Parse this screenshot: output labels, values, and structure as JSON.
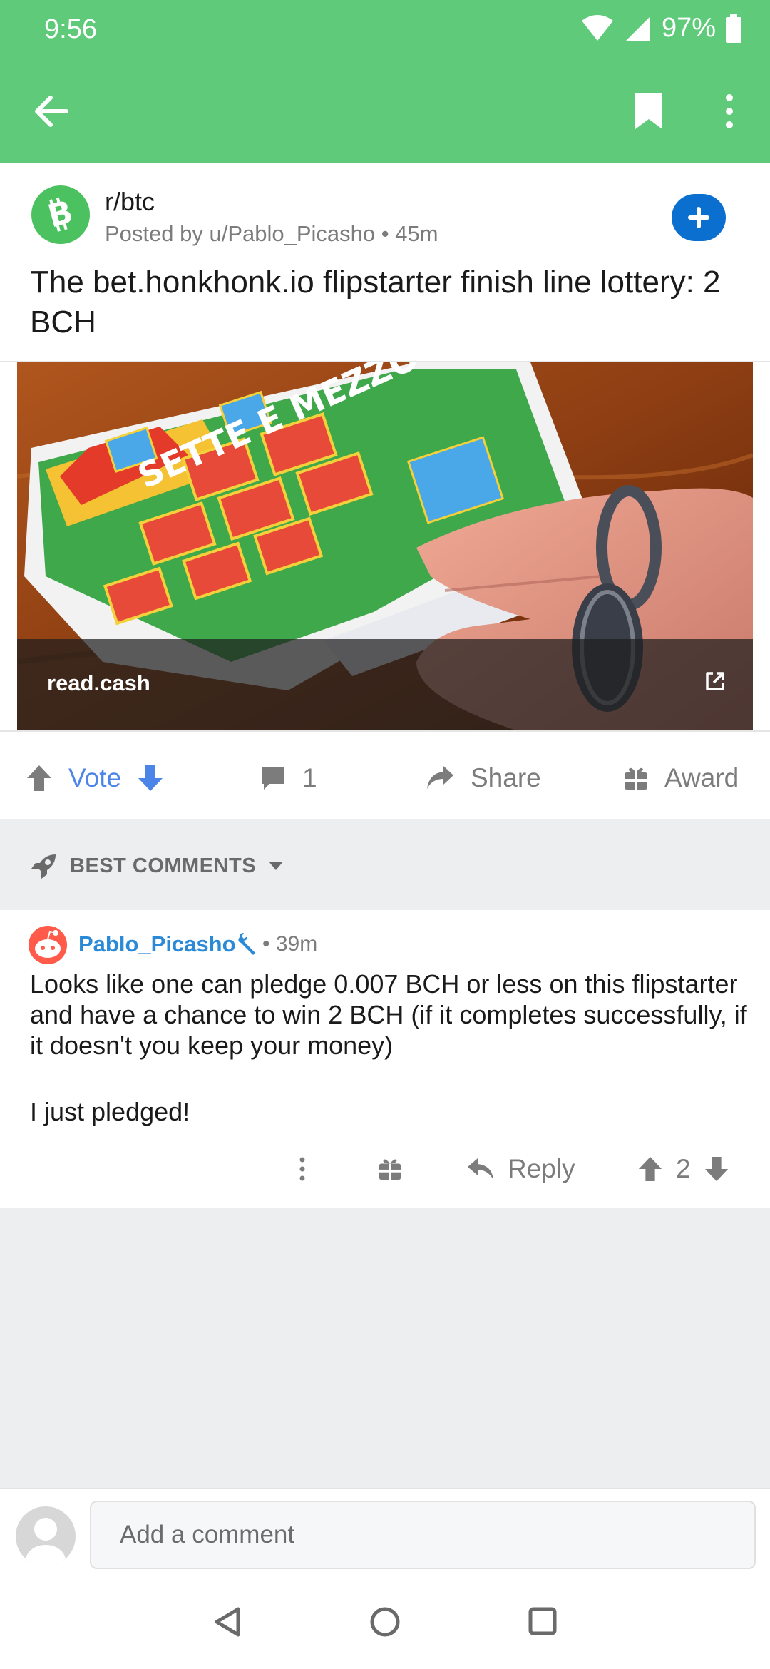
{
  "status": {
    "time": "9:56",
    "battery": "97%"
  },
  "post": {
    "subreddit": "r/btc",
    "posted_by": "Posted by u/Pablo_Picasho • 45m",
    "title": "The bet.honkhonk.io flipstarter finish line lottery: 2 BCH",
    "link_domain": "read.cash"
  },
  "actions": {
    "vote": "Vote",
    "comments": "1",
    "share": "Share",
    "award": "Award"
  },
  "sort": {
    "label": "BEST COMMENTS"
  },
  "comment": {
    "author": "Pablo_Picasho",
    "time": "• 39m",
    "body1": "Looks like one can pledge 0.007 BCH or less on this flipstarter and have a chance to win 2 BCH (if it completes successfully, if it doesn't you keep your money)",
    "body2": "I just pledged!",
    "reply": "Reply",
    "score": "2"
  },
  "composer": {
    "placeholder": "Add a comment"
  },
  "colors": {
    "appbar": "#5fca7a",
    "join": "#0a6fcf",
    "vote_blue": "#4c84e8",
    "author_blue": "#2a8ad8"
  }
}
